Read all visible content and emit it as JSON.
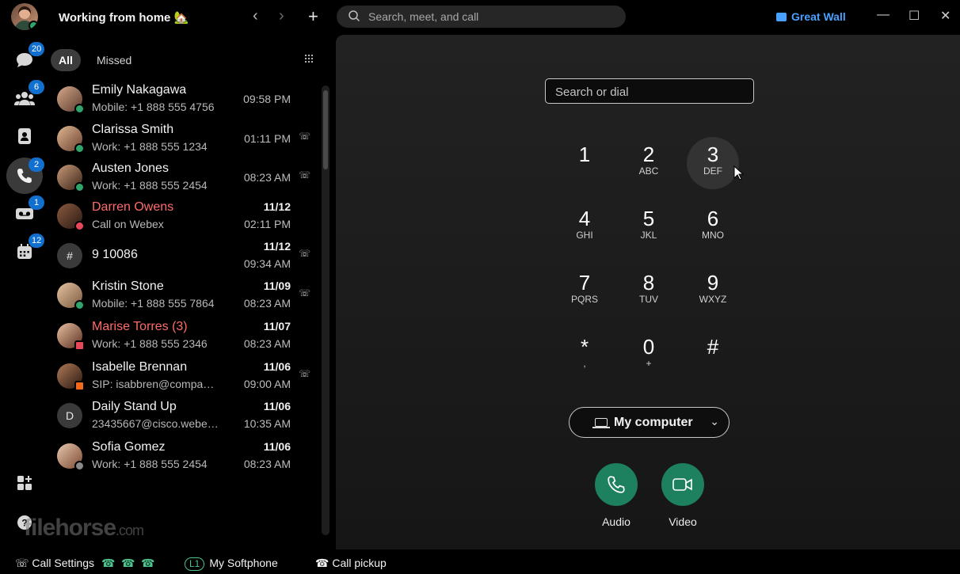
{
  "header": {
    "status_text": "Working from home 🏡",
    "back_icon": "‹",
    "forward_icon": "›",
    "new_icon": "+",
    "search_placeholder": "Search, meet, and call",
    "org_label": "Great Wall",
    "minimize_icon": "—",
    "maximize_icon": "☐",
    "close_icon": "✕"
  },
  "rail": {
    "items": [
      {
        "name": "messaging",
        "badge": "20"
      },
      {
        "name": "teams",
        "badge": "6"
      },
      {
        "name": "contacts",
        "badge": ""
      },
      {
        "name": "calling",
        "badge": "2"
      },
      {
        "name": "voicemail",
        "badge": "1"
      },
      {
        "name": "meetings",
        "badge": "12"
      },
      {
        "name": "apps",
        "badge": ""
      },
      {
        "name": "help",
        "badge": ""
      }
    ]
  },
  "history": {
    "tabs": [
      {
        "label": "All"
      },
      {
        "label": "Missed"
      }
    ],
    "rows": [
      {
        "name": "Emily Nakagawa",
        "sub": "Mobile: +1 888 555 4756",
        "date": "",
        "time": "09:58 PM",
        "missed": false,
        "status": "available",
        "call_type": ""
      },
      {
        "name": "Clarissa Smith",
        "sub": "Work: +1 888 555 1234",
        "date": "",
        "time": "01:11 PM",
        "missed": false,
        "status": "available",
        "call_type": "outgoing"
      },
      {
        "name": "Austen Jones",
        "sub": "Work: +1 888 555 2454",
        "date": "",
        "time": "08:23 AM",
        "missed": false,
        "status": "available",
        "call_type": "outgoing"
      },
      {
        "name": "Darren Owens",
        "sub": "Call on Webex",
        "date": "11/12",
        "time": "02:11 PM",
        "missed": true,
        "status": "dnd",
        "call_type": ""
      },
      {
        "name": "9 10086",
        "sub": "",
        "date": "11/12",
        "time": "09:34 AM",
        "missed": false,
        "status": "none",
        "call_type": "outgoing",
        "glyph": "#"
      },
      {
        "name": "Kristin Stone",
        "sub": "Mobile: +1 888 555 7864",
        "date": "11/09",
        "time": "08:23 AM",
        "missed": false,
        "status": "available",
        "call_type": "outgoing"
      },
      {
        "name": "Marise Torres (3)",
        "sub": "Work: +1 888 555 2346",
        "date": "11/07",
        "time": "08:23 AM",
        "missed": true,
        "status": "presenting",
        "call_type": ""
      },
      {
        "name": "Isabelle Brennan",
        "sub": "SIP: isabbren@company...",
        "date": "11/06",
        "time": "09:00 AM",
        "missed": false,
        "status": "meeting",
        "call_type": "outgoing"
      },
      {
        "name": "Daily Stand Up",
        "sub": "23435667@cisco.webex...",
        "date": "11/06",
        "time": "10:35 AM",
        "missed": false,
        "status": "none",
        "call_type": "",
        "glyph": "D"
      },
      {
        "name": "Sofia Gomez",
        "sub": "Work: +1 888 555 2454",
        "date": "11/06",
        "time": "08:23 AM",
        "missed": false,
        "status": "away",
        "call_type": ""
      }
    ]
  },
  "dialpad": {
    "placeholder": "Search or dial",
    "keys": [
      {
        "digit": "1",
        "letters": ""
      },
      {
        "digit": "2",
        "letters": "ABC"
      },
      {
        "digit": "3",
        "letters": "DEF"
      },
      {
        "digit": "4",
        "letters": "GHI"
      },
      {
        "digit": "5",
        "letters": "JKL"
      },
      {
        "digit": "6",
        "letters": "MNO"
      },
      {
        "digit": "7",
        "letters": "PQRS"
      },
      {
        "digit": "8",
        "letters": "TUV"
      },
      {
        "digit": "9",
        "letters": "WXYZ"
      },
      {
        "digit": "*",
        "letters": ","
      },
      {
        "digit": "0",
        "letters": "+"
      },
      {
        "digit": "#",
        "letters": ""
      }
    ],
    "device_label": "My computer",
    "audio_label": "Audio",
    "video_label": "Video"
  },
  "footer": {
    "call_settings": "Call Settings",
    "line_badge": "L1",
    "line_label": "My Softphone",
    "call_pickup": "Call pickup"
  },
  "watermark": {
    "text": "filehorse",
    "suffix": ".com"
  },
  "colors": {
    "accent": "#1170cf",
    "available": "#2fa56b",
    "missed": "#ff6b6b",
    "dnd": "#e8475b",
    "call_green": "#1d805f",
    "org_blue": "#49a1ff"
  }
}
